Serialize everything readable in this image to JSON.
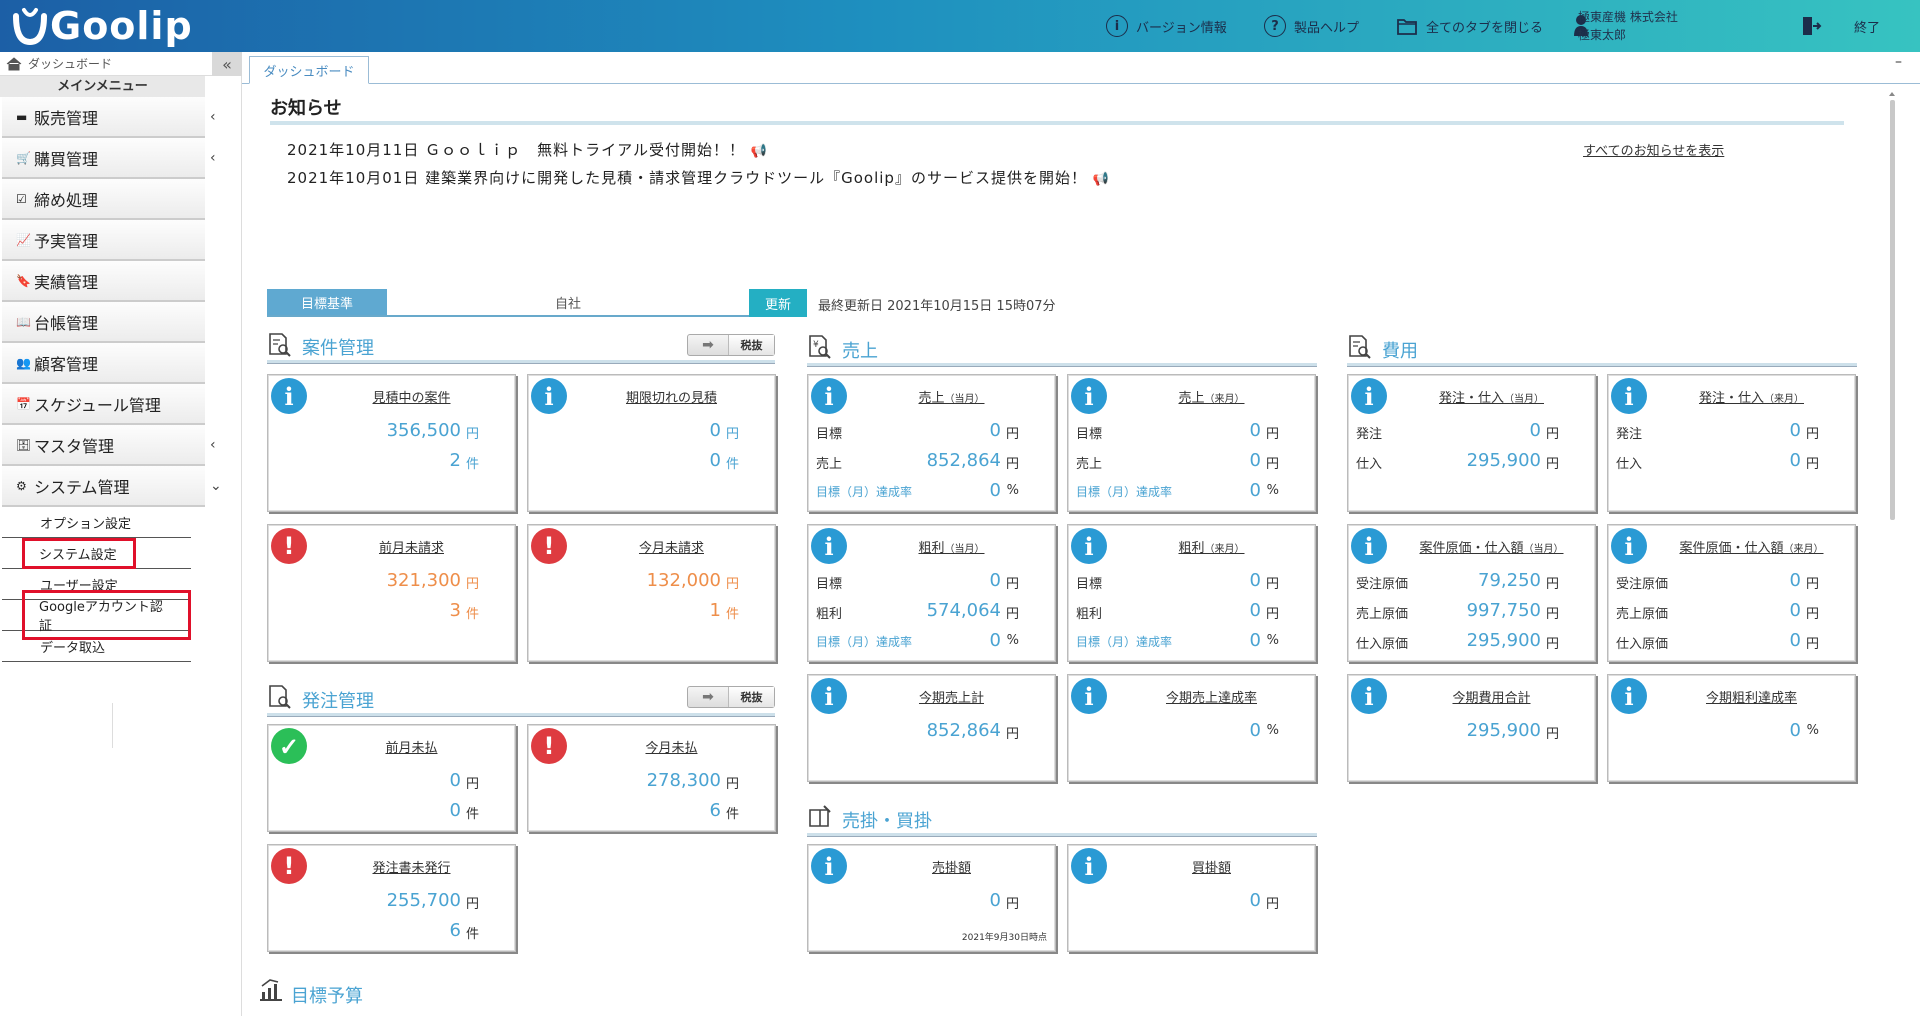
{
  "app": {
    "logo_text": "Goolip"
  },
  "header": {
    "version": "バージョン情報",
    "help": "製品ヘルプ",
    "close_tabs": "全てのタブを閉じる",
    "company": "極東産機 株式会社",
    "user": "極東太郎",
    "exit": "終了"
  },
  "sidebar": {
    "top_label": "ダッシュボード",
    "menu_title": "メインメニュー",
    "items": [
      {
        "label": "販売管理",
        "icon": "register-icon",
        "chevron": "‹"
      },
      {
        "label": "購買管理",
        "icon": "cart-icon",
        "chevron": "‹"
      },
      {
        "label": "締め処理",
        "icon": "checkbox-icon",
        "chevron": ""
      },
      {
        "label": "予実管理",
        "icon": "line-chart-icon",
        "chevron": ""
      },
      {
        "label": "実績管理",
        "icon": "bookmark-icon",
        "chevron": ""
      },
      {
        "label": "台帳管理",
        "icon": "book-icon",
        "chevron": ""
      },
      {
        "label": "顧客管理",
        "icon": "users-icon",
        "chevron": ""
      },
      {
        "label": "スケジュール管理",
        "icon": "calendar-icon",
        "chevron": ""
      },
      {
        "label": "マスタ管理",
        "icon": "database-icon",
        "chevron": "‹"
      },
      {
        "label": "システム管理",
        "icon": "gear-icon",
        "chevron": "⌄"
      }
    ],
    "subitems": [
      {
        "label": "オプション設定",
        "highlight": false
      },
      {
        "label": "システム設定",
        "highlight": true
      },
      {
        "label": "ユーザー設定",
        "highlight": false
      },
      {
        "label": "Googleアカウント認証",
        "highlight": true
      },
      {
        "label": "データ取込",
        "highlight": false
      }
    ]
  },
  "tabs": [
    {
      "label": "ダッシュボード"
    }
  ],
  "news": {
    "title": "お知らせ",
    "items": [
      "2021年10月11日 Ｇｏｏｌｉｐ　無料トライアル受付開始！！",
      "2021年10月01日 建築業界向けに開発した見積・請求管理クラウドツール『Goolip』のサービス提供を開始！"
    ],
    "show_all": "すべてのお知らせを表示"
  },
  "target": {
    "label": "目標基準",
    "selected": "自社",
    "update": "更新",
    "last_updated": "最終更新日 2021年10月15日 15時07分"
  },
  "sections": {
    "anken": "案件管理",
    "hatchu": "発注管理",
    "uriage": "売上",
    "hiyou": "費用",
    "urikake": "売掛・買掛",
    "mokuhyo": "目標予算",
    "tax_toggle": "税抜"
  },
  "units": {
    "yen": "円",
    "ken": "件",
    "pct": "%"
  },
  "cards": {
    "mitsumori_chu": {
      "title": "見積中の案件",
      "v1": "356,500",
      "v2": "2"
    },
    "kigen_gire": {
      "title": "期限切れの見積",
      "v1": "0",
      "v2": "0"
    },
    "zengetsu_mi": {
      "title": "前月未請求",
      "v1": "321,300",
      "v2": "3"
    },
    "kongetsu_mi": {
      "title": "今月未請求",
      "v1": "132,000",
      "v2": "1"
    },
    "zengetsu_mibarai": {
      "title": "前月未払",
      "v1": "0",
      "v2": "0"
    },
    "kongetsu_mibarai": {
      "title": "今月未払",
      "v1": "278,300",
      "v2": "6"
    },
    "hatchusho": {
      "title": "発注書未発行",
      "v1": "255,700",
      "v2": "6"
    },
    "uriage_to": {
      "title": "売上",
      "sub": "（当月）",
      "l1": "目標",
      "v1": "0",
      "l2": "売上",
      "v2": "852,864",
      "l3": "目標（月）達成率",
      "v3": "0"
    },
    "uriage_rai": {
      "title": "売上",
      "sub": "（来月）",
      "l1": "目標",
      "v1": "0",
      "l2": "売上",
      "v2": "0",
      "l3": "目標（月）達成率",
      "v3": "0"
    },
    "arari_to": {
      "title": "粗利",
      "sub": "（当月）",
      "l1": "目標",
      "v1": "0",
      "l2": "粗利",
      "v2": "574,064",
      "l3": "目標（月）達成率",
      "v3": "0"
    },
    "arari_rai": {
      "title": "粗利",
      "sub": "（来月）",
      "l1": "目標",
      "v1": "0",
      "l2": "粗利",
      "v2": "0",
      "l3": "目標（月）達成率",
      "v3": "0"
    },
    "konki_uriage": {
      "title": "今期売上計",
      "v1": "852,864"
    },
    "konki_tassei": {
      "title": "今期売上達成率",
      "v1": "0"
    },
    "hatchu_to": {
      "title": "発注・仕入",
      "sub": "（当月）",
      "l1": "発注",
      "v1": "0",
      "l2": "仕入",
      "v2": "295,900"
    },
    "hatchu_rai": {
      "title": "発注・仕入",
      "sub": "（来月）",
      "l1": "発注",
      "v1": "0",
      "l2": "仕入",
      "v2": "0"
    },
    "genka_to": {
      "title": "案件原価・仕入額",
      "sub": "（当月）",
      "l1": "受注原価",
      "v1": "79,250",
      "l2": "売上原価",
      "v2": "997,750",
      "l3": "仕入原価",
      "v3": "295,900"
    },
    "genka_rai": {
      "title": "案件原価・仕入額",
      "sub": "（来月）",
      "l1": "受注原価",
      "v1": "0",
      "l2": "売上原価",
      "v2": "0",
      "l3": "仕入原価",
      "v3": "0"
    },
    "konki_hiyou": {
      "title": "今期費用合計",
      "v1": "295,900"
    },
    "konki_arari": {
      "title": "今期粗利達成率",
      "v1": "0"
    },
    "urikake": {
      "title": "売掛額",
      "v1": "0",
      "note": "2021年9月30日時点"
    },
    "kaikake": {
      "title": "買掛額",
      "v1": "0"
    }
  }
}
